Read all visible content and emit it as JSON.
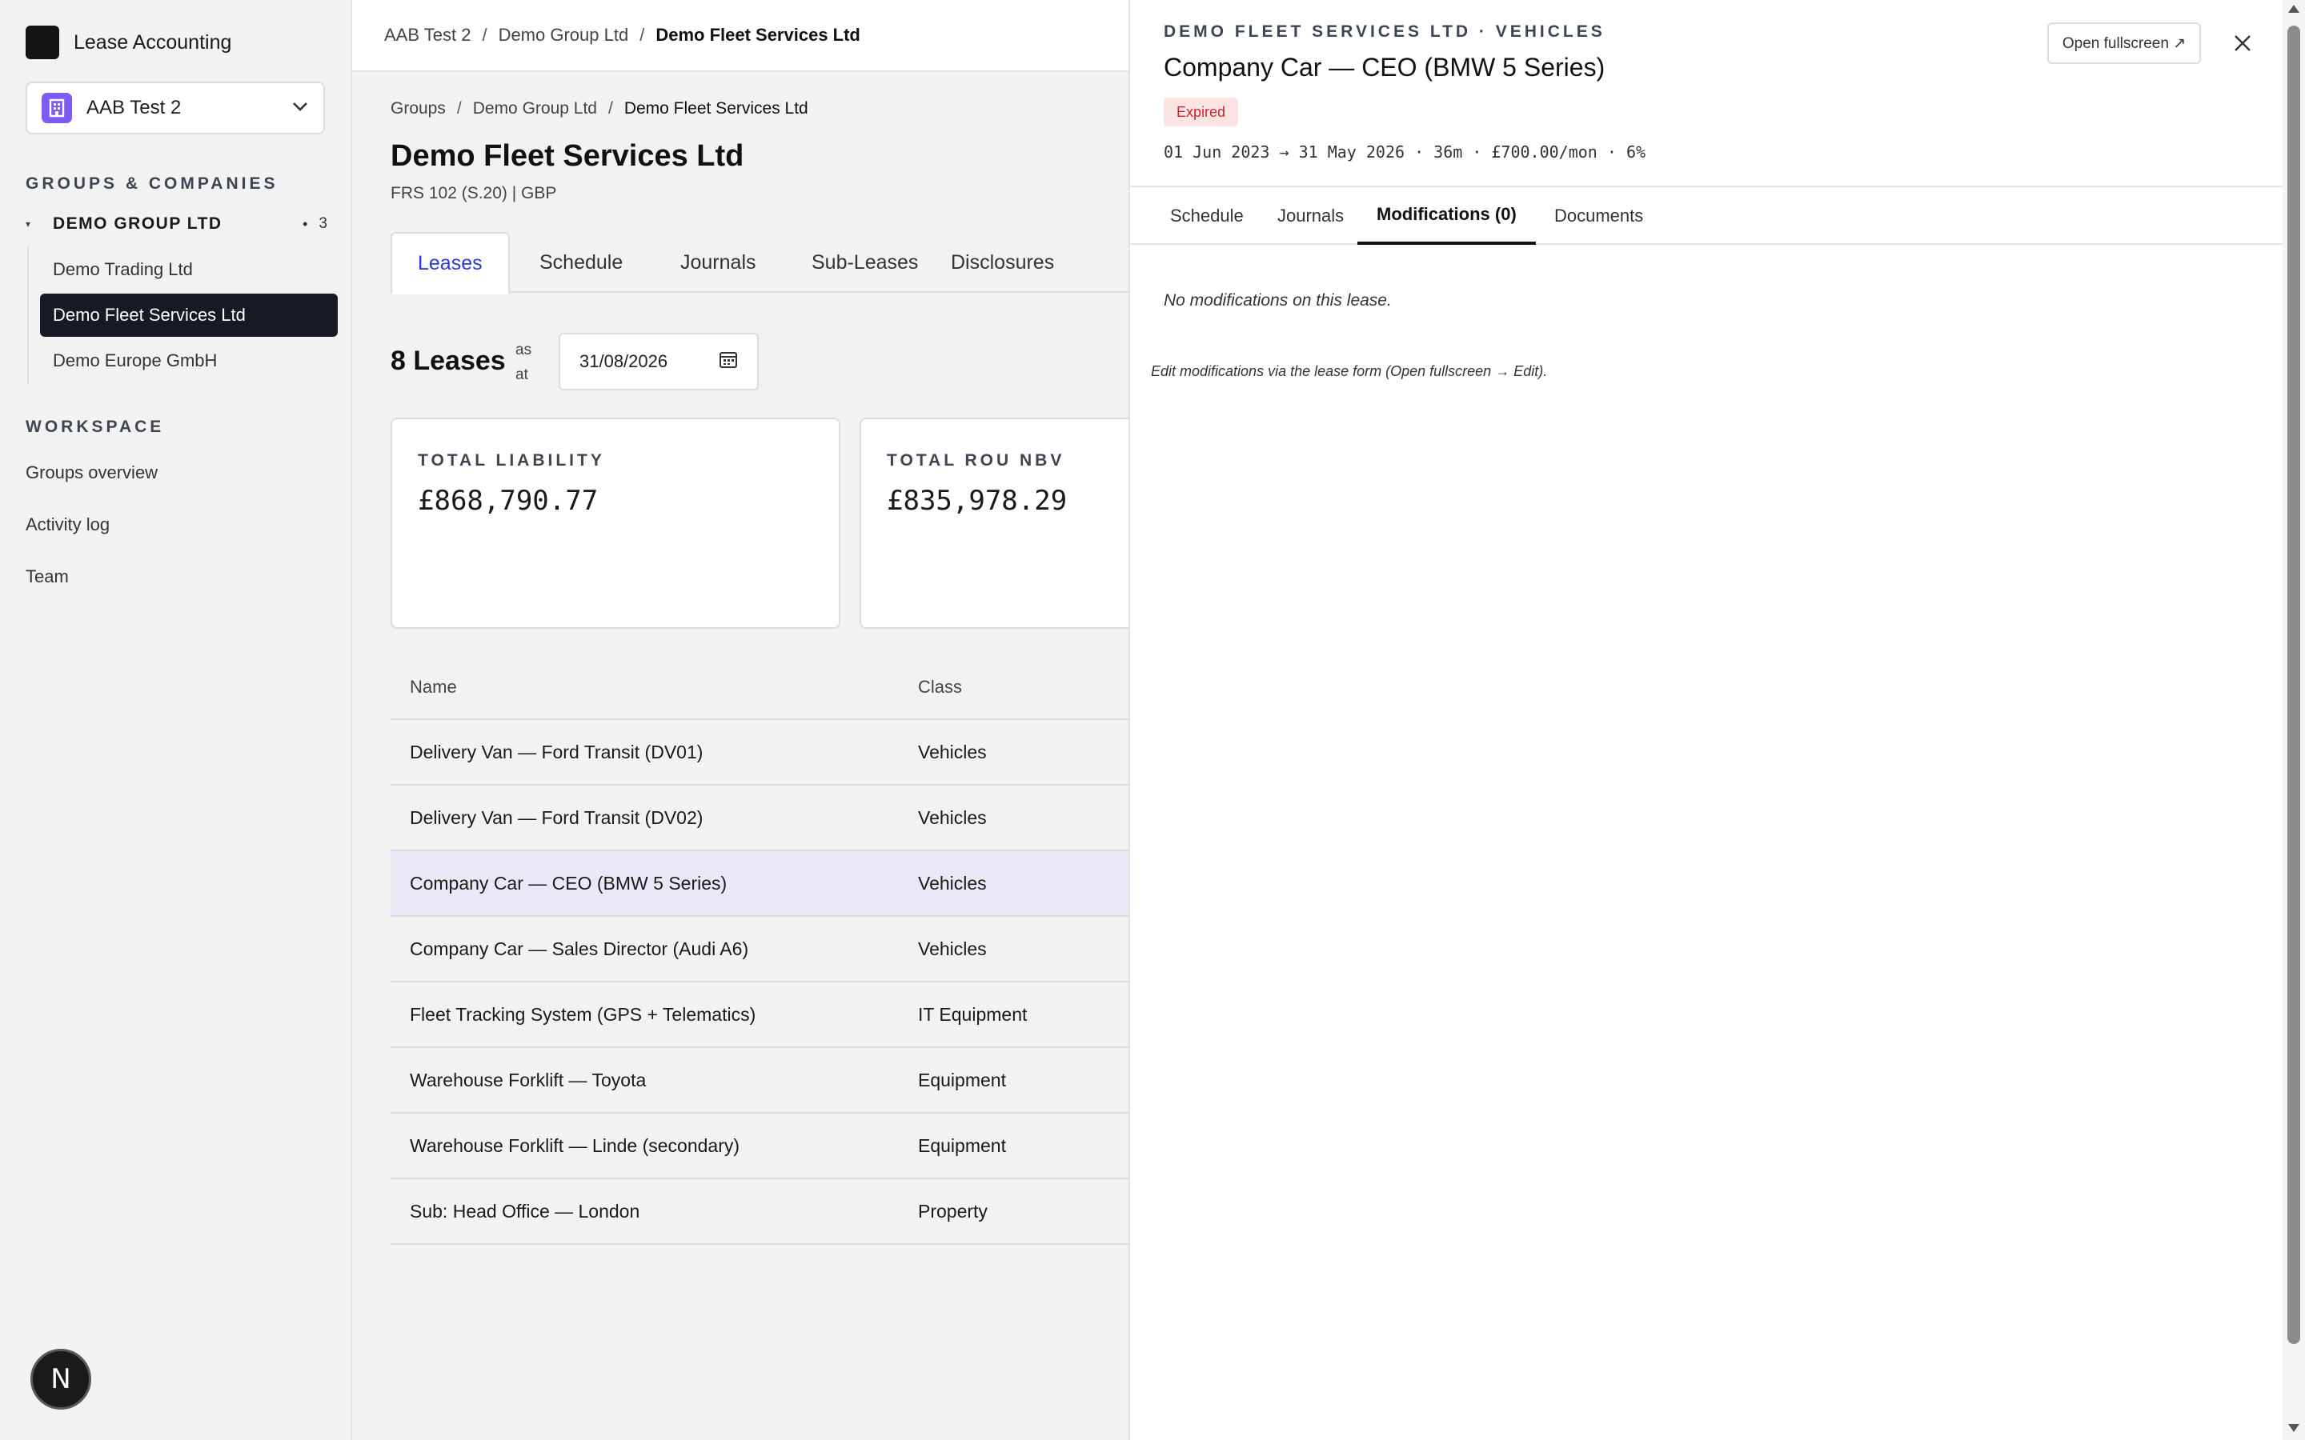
{
  "app": {
    "title": "Lease Accounting"
  },
  "org_selector": {
    "value": "AAB Test 2",
    "icon": "building-icon"
  },
  "sidebar": {
    "groups_title": "GROUPS & COMPANIES",
    "group": {
      "name": "DEMO GROUP LTD",
      "count": "3"
    },
    "companies": [
      {
        "label": "Demo Trading Ltd"
      },
      {
        "label": "Demo Fleet Services Ltd"
      },
      {
        "label": "Demo Europe GmbH"
      }
    ],
    "workspace_title": "WORKSPACE",
    "workspace_items": [
      {
        "label": "Groups overview"
      },
      {
        "label": "Activity log"
      },
      {
        "label": "Team"
      }
    ]
  },
  "topbar": {
    "crumbs": [
      "AAB Test 2",
      "Demo Group Ltd",
      "Demo Fleet Services Ltd"
    ]
  },
  "page": {
    "crumbs": [
      "Groups",
      "Demo Group Ltd",
      "Demo Fleet Services Ltd"
    ],
    "title": "Demo Fleet Services Ltd",
    "subtitle": "FRS 102 (S.20) | GBP",
    "tabs": [
      "Leases",
      "Schedule",
      "Journals",
      "Sub-Leases",
      "Disclosures"
    ],
    "lease_count": "8 Leases",
    "as_at_1": "as",
    "as_at_2": "at",
    "date": "31/08/2026",
    "stats": [
      {
        "label": "TOTAL LIABILITY",
        "value": "£868,790.77"
      },
      {
        "label": "TOTAL ROU NBV",
        "value": "£835,978.29"
      }
    ]
  },
  "table": {
    "headers": {
      "name": "Name",
      "class": "Class"
    },
    "rows": [
      {
        "name": "Delivery Van — Ford Transit (DV01)",
        "class": "Vehicles"
      },
      {
        "name": "Delivery Van — Ford Transit (DV02)",
        "class": "Vehicles"
      },
      {
        "name": "Company Car — CEO (BMW 5 Series)",
        "class": "Vehicles"
      },
      {
        "name": "Company Car — Sales Director (Audi A6)",
        "class": "Vehicles"
      },
      {
        "name": "Fleet Tracking System (GPS + Telematics)",
        "class": "IT Equipment"
      },
      {
        "name": "Warehouse Forklift — Toyota",
        "class": "Equipment"
      },
      {
        "name": "Warehouse Forklift — Linde (secondary)",
        "class": "Equipment"
      },
      {
        "name": "Sub: Head Office — London",
        "class": "Property"
      }
    ]
  },
  "drawer": {
    "eyebrow": "DEMO FLEET SERVICES LTD · VEHICLES",
    "title": "Company Car — CEO (BMW 5 Series)",
    "status": "Expired",
    "meta": "01 Jun 2023 → 31 May 2026 · 36m · £700.00/mon · 6%",
    "fullscreen_label": "Open fullscreen ↗",
    "tabs": [
      "Schedule",
      "Journals",
      "Modifications (0)",
      "Documents"
    ],
    "empty_message": "No modifications on this lease.",
    "hint": "Edit modifications via the lease form (Open fullscreen → Edit)."
  },
  "colors": {
    "accent": "#2b3bd6",
    "org_icon": "#7c5cf0",
    "expired_bg": "#fde4e4",
    "expired_text": "#c0282d",
    "selected_row": "#e8e8f6",
    "active_company": "#161a22"
  },
  "fab": {
    "label": "N"
  }
}
